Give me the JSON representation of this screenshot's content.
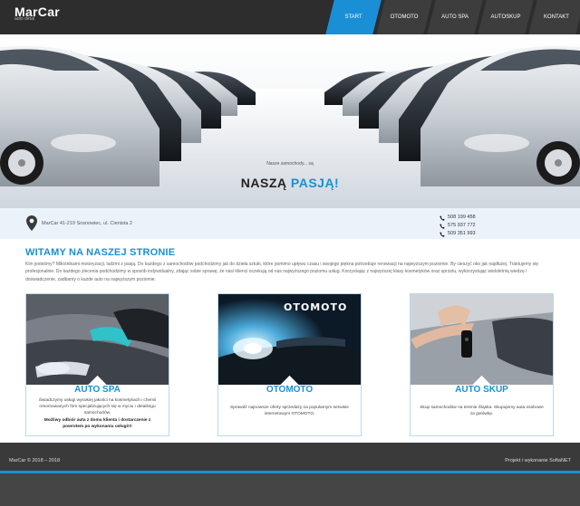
{
  "header": {
    "logo": "MarCar",
    "logo_sub": "auto detal",
    "nav": [
      "START",
      "OTOMOTO",
      "AUTO SPA",
      "AUTOSKUP",
      "KONTAKT"
    ]
  },
  "hero": {
    "tagline": "Nasze samochody... są",
    "title_part1": "NASZĄ",
    "title_part2": "PASJĄ!"
  },
  "contact": {
    "address": "MarCar 41-219 Sosnowiec, ul. Cienista 2",
    "phones": [
      "508 199 458",
      "575 937 772",
      "509 351 993"
    ]
  },
  "welcome": {
    "title": "WITAMY NA NASZEJ STRONIE",
    "text": "Kim jesteśmy? Miłośnikami motoryzacji, ludźmi z pasją. Do każdego z samochodów podchodzimy jak do dzieła sztuki, które pomimo upływu czasu i swojego piękna potrzebuje renowacji na najwyższym poziomie. By cieszyć oko jak najdłużej. Traktujemy się profesjonalnie. Do każdego zlecenia podchodzimy w sposób indywidualny, zdając sobie sprawę, że nasi klienci oczekują od nas najwyższego poziomu usług. Korzystając z najwyższej klasy kosmetyków oraz sprzętu, wykorzystując wieloletnią wiedzę i doświadczenie, zadbamy o każde auto na najwyższym poziomie."
  },
  "cards": [
    {
      "title": "AUTO SPA",
      "text": "Świadczymy usługi wysokiej jakości na kosmetykach i chemii renomowanych firm specjalizujących się w myciu i detailingu samochodów.",
      "bold": "Możliwy odbiór auta z domu klienta i dostarczenie z powrotem po wykonaniu usługi!!!"
    },
    {
      "title": "OTOMOTO",
      "image_text": "OTOMOTO",
      "text": "Sprawdź najnowsze oferty sprzedaży na popularnym serwisie internetowym OTOMOTO.",
      "bold": ""
    },
    {
      "title": "AUTO SKUP",
      "text": "Skup samochodów na terenie Śląska. Skupujemy auta osobowe za gotówkę.",
      "bold": ""
    }
  ],
  "footer": {
    "left": "MarCar © 2018 – 2018",
    "right": "Projekt i wykonanie SoftaNET"
  },
  "colors": {
    "accent": "#1a8fd6",
    "header_bg": "#2d2d2d",
    "footer_bg": "#3a3a3a"
  }
}
